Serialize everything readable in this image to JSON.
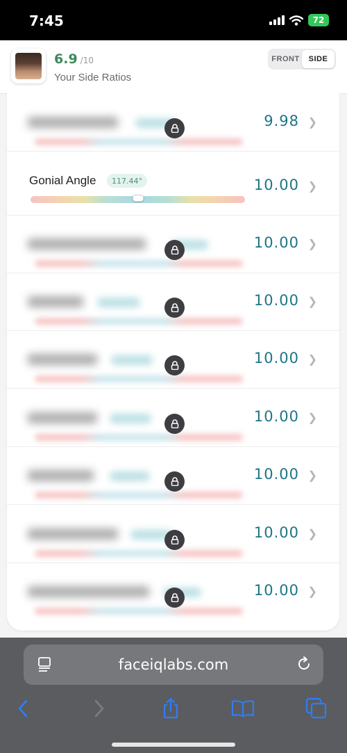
{
  "status_bar": {
    "time": "7:45",
    "battery": "72"
  },
  "header": {
    "score": "6.9",
    "score_denominator": "/10",
    "subtitle": "Your Side Ratios",
    "toggle": {
      "front_label": "FRONT",
      "side_label": "SIDE",
      "selected": "SIDE"
    }
  },
  "rows": [
    {
      "type": "locked",
      "value": "9.98"
    },
    {
      "type": "unlocked",
      "name": "Gonial Angle",
      "chip": "117.44°",
      "value": "10.00",
      "marker_position": 0.5
    },
    {
      "type": "locked",
      "value": "10.00"
    },
    {
      "type": "locked",
      "value": "10.00"
    },
    {
      "type": "locked",
      "value": "10.00"
    },
    {
      "type": "locked",
      "value": "10.00"
    },
    {
      "type": "locked",
      "value": "10.00"
    },
    {
      "type": "locked",
      "value": "10.00"
    },
    {
      "type": "locked",
      "value": "10.00"
    }
  ],
  "browser": {
    "url": "faceiqlabs.com"
  },
  "colors": {
    "accent_value": "#1e7585",
    "score_green": "#3c8a5a",
    "ios_blue": "#2f7df6"
  }
}
